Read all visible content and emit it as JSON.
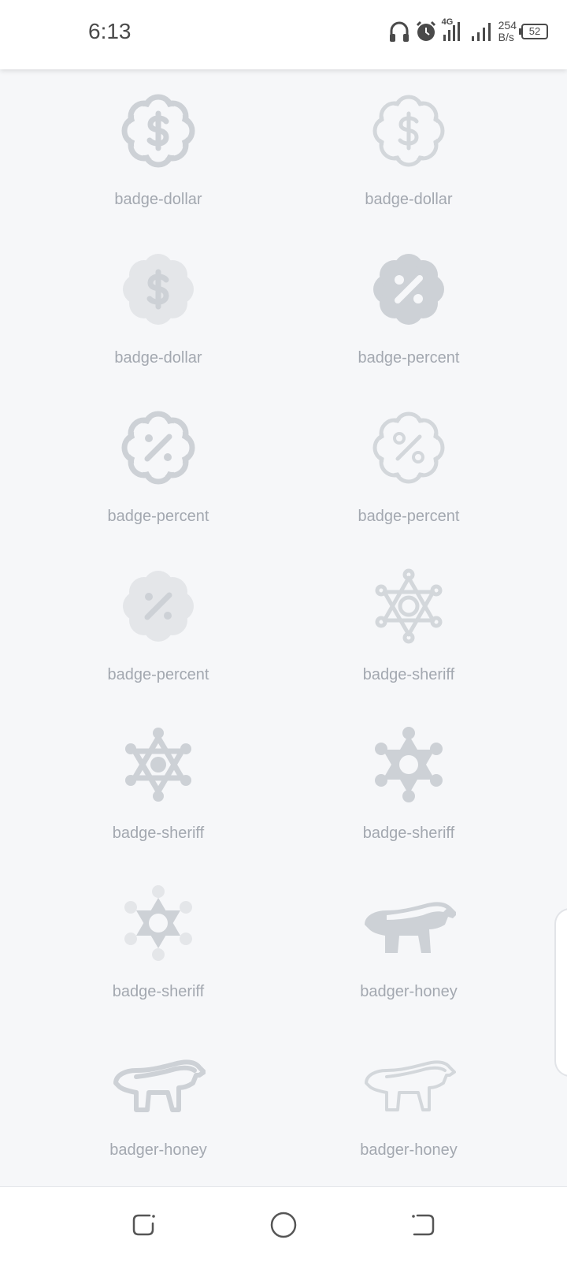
{
  "status_bar": {
    "time": "6:13",
    "network_type": "4G",
    "net_speed_value": "254",
    "net_speed_unit": "B/s",
    "battery_level": "52",
    "icons": [
      "headphones-icon",
      "alarm-icon",
      "signal-4g-icon",
      "signal-icon",
      "battery-icon"
    ]
  },
  "icon_grid": {
    "icon_color": "#cdd1d6",
    "icon_light_color": "#e4e6e9",
    "label_color": "#a3a8b0",
    "items": [
      {
        "label": "badge-dollar",
        "icon": "badge-dollar-outline-icon"
      },
      {
        "label": "badge-dollar",
        "icon": "badge-dollar-outline-light-icon"
      },
      {
        "label": "badge-dollar",
        "icon": "badge-dollar-duotone-icon"
      },
      {
        "label": "badge-percent",
        "icon": "badge-percent-solid-icon"
      },
      {
        "label": "badge-percent",
        "icon": "badge-percent-outline-icon"
      },
      {
        "label": "badge-percent",
        "icon": "badge-percent-outline-light-icon"
      },
      {
        "label": "badge-percent",
        "icon": "badge-percent-duotone-icon"
      },
      {
        "label": "badge-sheriff",
        "icon": "badge-sheriff-thin-icon"
      },
      {
        "label": "badge-sheriff",
        "icon": "badge-sheriff-outline-icon"
      },
      {
        "label": "badge-sheriff",
        "icon": "badge-sheriff-solid-icon"
      },
      {
        "label": "badge-sheriff",
        "icon": "badge-sheriff-duotone-icon"
      },
      {
        "label": "badger-honey",
        "icon": "badger-honey-solid-icon"
      },
      {
        "label": "badger-honey",
        "icon": "badger-honey-outline-icon"
      },
      {
        "label": "badger-honey",
        "icon": "badger-honey-outline-light-icon"
      }
    ]
  },
  "nav_bar": {
    "buttons": [
      "recents-button",
      "home-button",
      "back-button"
    ]
  }
}
